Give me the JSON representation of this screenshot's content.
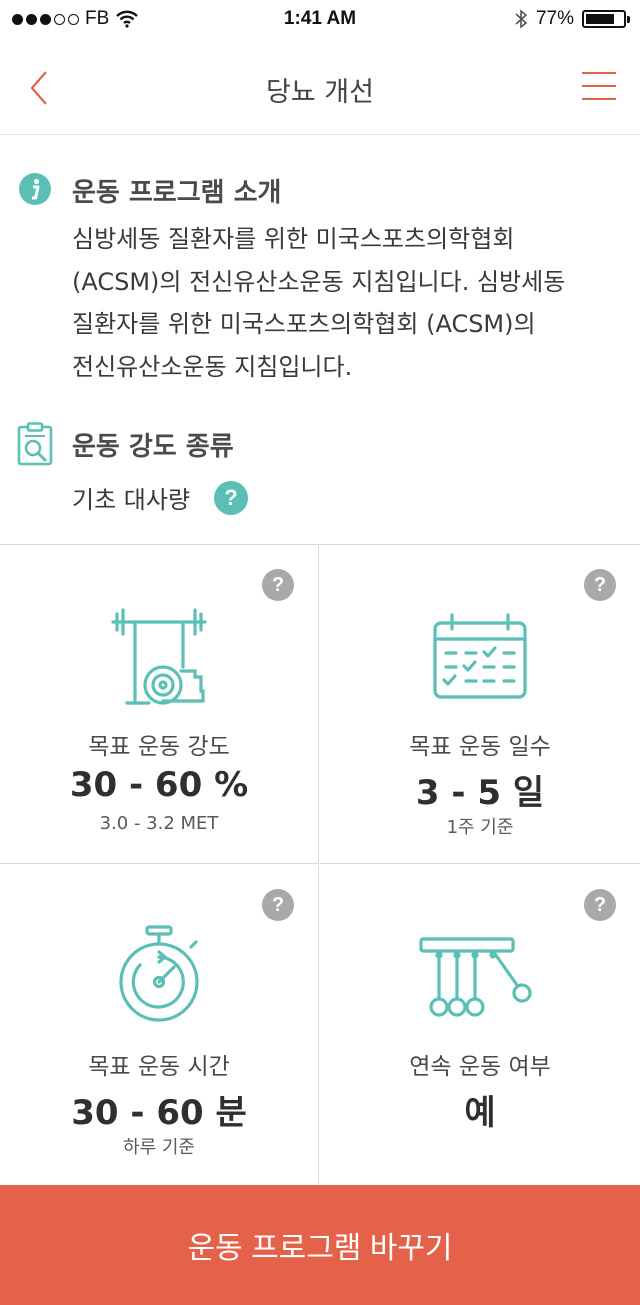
{
  "status_bar": {
    "carrier": "FB",
    "time": "1:41 AM",
    "battery": "77%",
    "battery_level": 0.77
  },
  "header": {
    "title": "당뇨 개선"
  },
  "intro": {
    "title": "운동 프로그램 소개",
    "lines": [
      "심방세동 질환자를 위한 미국스포츠의학협회",
      "(ACSM)의 전신유산소운동 지침입니다. 심방세동",
      "질환자를 위한 미국스포츠의학협회 (ACSM)의",
      "전신유산소운동 지침입니다."
    ]
  },
  "intensity_type": {
    "title": "운동 강도 종류",
    "value": "기초 대사량"
  },
  "help_glyph": "?",
  "cards": [
    {
      "label": "목표 운동 강도",
      "value": "30 - 60 %",
      "sub": "3.0 - 3.2 MET",
      "icon": "barbell-icon"
    },
    {
      "label": "목표 운동 일수",
      "value": "3 - 5 일",
      "sub": "1주 기준",
      "icon": "calendar-icon"
    },
    {
      "label": "목표 운동 시간",
      "value": "30 - 60 분",
      "sub": "하루 기준",
      "icon": "stopwatch-icon"
    },
    {
      "label": "연속 운동 여부",
      "value": "예",
      "sub": "",
      "icon": "newtons-cradle-icon"
    }
  ],
  "cta": {
    "label": "운동 프로그램 바꾸기"
  },
  "colors": {
    "accent": "#e5624a",
    "teal": "#5bbfb5",
    "gray_help": "#a9a9a9"
  }
}
